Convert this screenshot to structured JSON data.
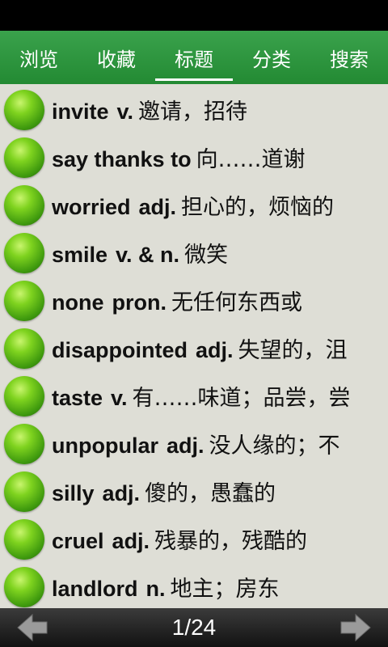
{
  "tabs": [
    {
      "label": "浏览",
      "active": false
    },
    {
      "label": "收藏",
      "active": false
    },
    {
      "label": "标题",
      "active": true
    },
    {
      "label": "分类",
      "active": false
    },
    {
      "label": "搜索",
      "active": false
    }
  ],
  "entries": [
    {
      "word": "invite",
      "pos": "v.",
      "meaning": "邀请，招待"
    },
    {
      "word": "say thanks to",
      "pos": "",
      "meaning": "向……道谢"
    },
    {
      "word": "worried",
      "pos": "adj.",
      "meaning": "担心的，烦恼的"
    },
    {
      "word": "smile",
      "pos": "v. & n.",
      "meaning": "微笑"
    },
    {
      "word": "none",
      "pos": "pron.",
      "meaning": "无任何东西或"
    },
    {
      "word": "disappointed",
      "pos": "adj.",
      "meaning": "失望的，沮"
    },
    {
      "word": "taste",
      "pos": "v.",
      "meaning": "有……味道；品尝，尝"
    },
    {
      "word": "unpopular",
      "pos": "adj.",
      "meaning": "没人缘的；不"
    },
    {
      "word": "silly",
      "pos": "adj.",
      "meaning": "傻的，愚蠢的"
    },
    {
      "word": "cruel",
      "pos": "adj.",
      "meaning": "残暴的，残酷的"
    },
    {
      "word": "landlord",
      "pos": "n.",
      "meaning": "地主；房东"
    }
  ],
  "pager": {
    "text": "1/24"
  },
  "colors": {
    "tabbar": "#2e9640",
    "background": "#deded6",
    "bottombar": "#1e1e1e"
  }
}
